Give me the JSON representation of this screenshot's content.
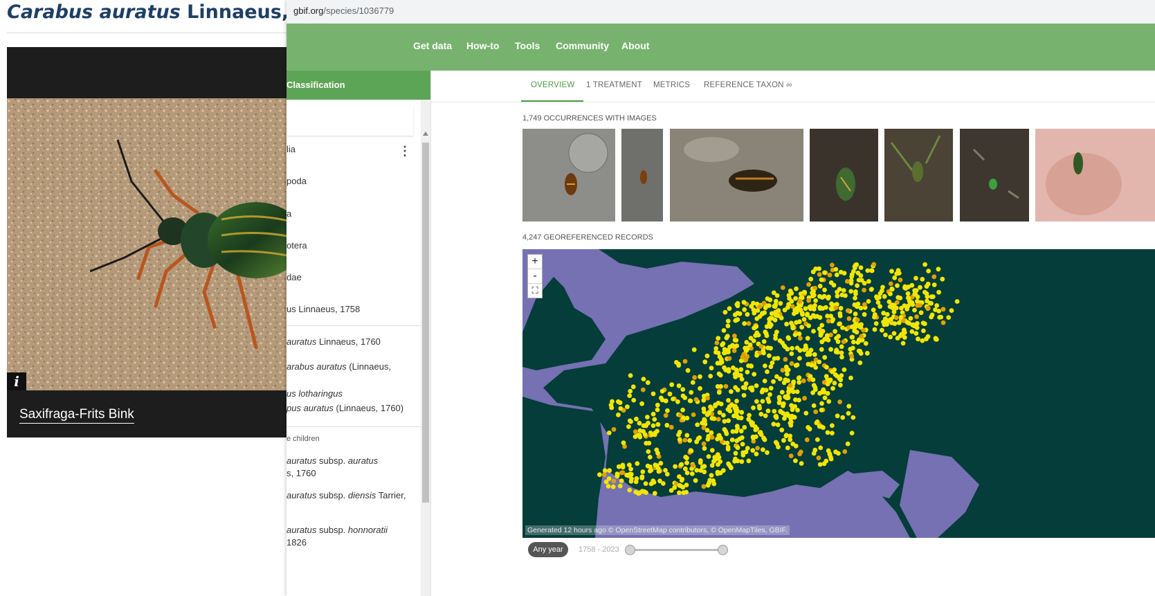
{
  "left_card": {
    "title_italic": "Carabus auratus",
    "title_rest": " Linnaeus,",
    "info_glyph": "i",
    "photo_credit": "Saxifraga-Frits Bink"
  },
  "browser": {
    "url_domain": "gbif.org",
    "url_path": "/species/1036779"
  },
  "nav": [
    "Get data",
    "How-to",
    "Tools",
    "Community",
    "About"
  ],
  "sidebar": {
    "header": "Classification",
    "more_glyph": "⋮",
    "ranks": [
      "lia",
      "poda",
      "a",
      "otera",
      "dae"
    ],
    "genus": "us Linnaeus, 1758",
    "species": {
      "italic": "auratus",
      "rest": " Linnaeus, 1760"
    },
    "synonyms": [
      {
        "italic": "arabus auratus",
        "rest": " (Linnaeus,"
      },
      {
        "italic": "us lotharingus",
        "rest": ""
      },
      {
        "italic": "pus auratus",
        "rest": " (Linnaeus, 1760)"
      }
    ],
    "children_label": "e children",
    "children": [
      {
        "italic_a": "auratus",
        "mid": " subsp. ",
        "italic_b": "auratus",
        "line2": "s, 1760"
      },
      {
        "italic_a": "auratus",
        "mid": " subsp. ",
        "italic_b": "diensis",
        "rest": " Tarrier,"
      },
      {
        "italic_a": "auratus",
        "mid": " subsp. ",
        "italic_b": "honnoratii",
        "line2": "1826"
      }
    ]
  },
  "tabs": [
    "OVERVIEW",
    "1 TREATMENT",
    "METRICS",
    "REFERENCE TAXON ∞"
  ],
  "images_label": "1,749 OCCURRENCES WITH IMAGES",
  "records_label": "4,247 GEOREFERENCED RECORDS",
  "map": {
    "zoom_in": "+",
    "zoom_out": "-",
    "fullscreen_glyph": "⛶",
    "attribution": "Generated 12 hours ago © OpenStreetMap contributors, © OpenMapTiles, GBIF.",
    "colors": {
      "sea": "#7571b2",
      "land": "#043d3a",
      "hex": "#f2e600",
      "hex_dense": "#e0a100"
    }
  },
  "year_filter": {
    "pill": "Any year",
    "range": "1758 - 2023"
  }
}
